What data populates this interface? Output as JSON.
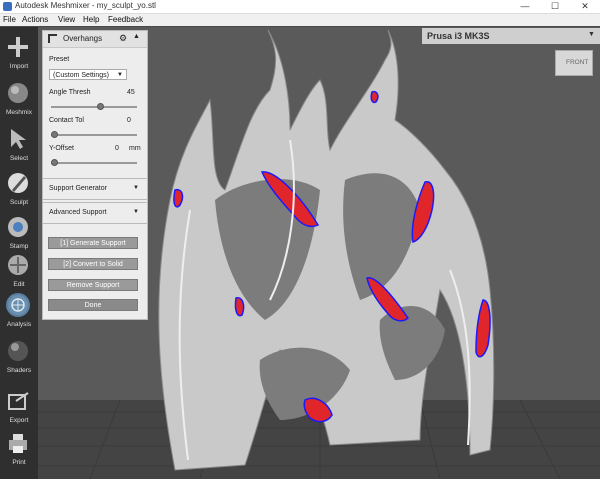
{
  "window": {
    "title": "Autodesk Meshmixer - my_sculpt_yo.stl",
    "minimize": "—",
    "maximize": "☐",
    "close": "✕"
  },
  "menu": [
    "File",
    "Actions",
    "View",
    "Help",
    "Feedback"
  ],
  "tools": [
    {
      "label": "Import",
      "icon": "plus-icon"
    },
    {
      "label": "Meshmix",
      "icon": "meshmix-icon"
    },
    {
      "label": "Select",
      "icon": "cursor-icon"
    },
    {
      "label": "Sculpt",
      "icon": "brush-icon"
    },
    {
      "label": "Stamp",
      "icon": "stamp-icon"
    },
    {
      "label": "Edit",
      "icon": "edit-icon"
    },
    {
      "label": "Analysis",
      "icon": "analysis-icon",
      "active": true
    },
    {
      "label": "Shaders",
      "icon": "sphere-icon"
    },
    {
      "label": "Export",
      "icon": "export-icon"
    },
    {
      "label": "Print",
      "icon": "printer-icon"
    }
  ],
  "panel": {
    "title": "Overhangs",
    "gear": "⚙",
    "collapse": "▲",
    "preset_label": "Preset",
    "preset_value": "(Custom Settings)",
    "angle_label": "Angle Thresh",
    "angle_value": "45",
    "contact_label": "Contact Tol",
    "contact_value": "0",
    "yoffset_label": "Y-Offset",
    "yoffset_value": "0",
    "yoffset_unit": "mm",
    "support_generator": "Support Generator",
    "advanced_support": "Advanced Support",
    "btn_generate": "[1] Generate Support",
    "btn_convert": "[2] Convert to Solid",
    "btn_remove": "Remove Support",
    "btn_done": "Done"
  },
  "printer": {
    "name": "Prusa i3 MK3S",
    "dropdown": "▼"
  },
  "viewcube": {
    "label": "FRONT"
  },
  "colors": {
    "accent": "#5a7fa0",
    "overhang": "#e0252b",
    "edge": "#1a1aff"
  }
}
